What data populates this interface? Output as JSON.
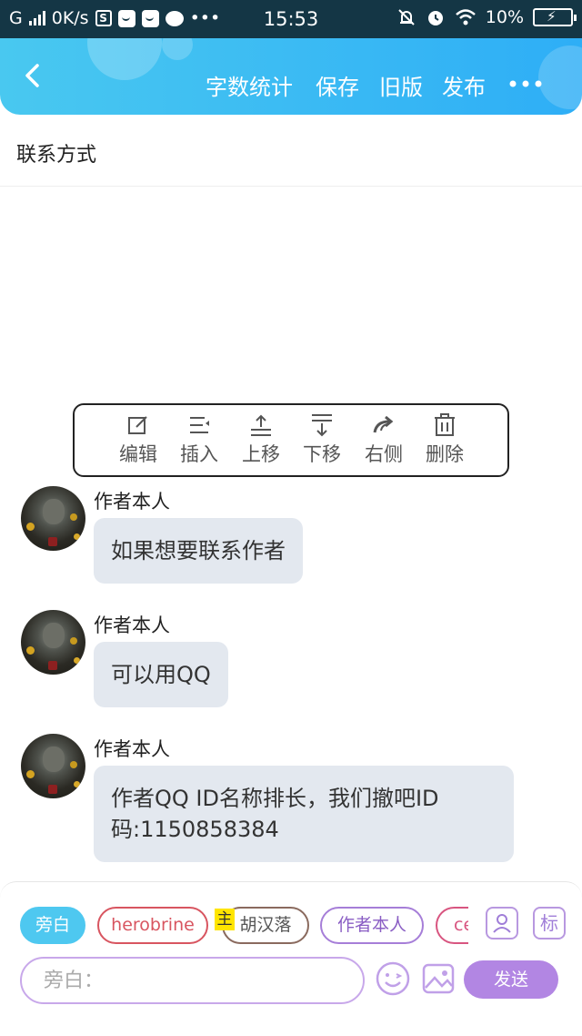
{
  "status_bar": {
    "carrier": "G",
    "net_speed": "0K/s",
    "time": "15:53",
    "battery": "10%"
  },
  "header": {
    "actions": [
      "字数统计",
      "保存",
      "旧版",
      "发布"
    ]
  },
  "page": {
    "title": "联系方式"
  },
  "toolbar": {
    "items": [
      "编辑",
      "插入",
      "上移",
      "下移",
      "右侧",
      "删除"
    ]
  },
  "messages": [
    {
      "sender": "作者本人",
      "text": "如果想要联系作者"
    },
    {
      "sender": "作者本人",
      "text": "可以用QQ"
    },
    {
      "sender": "作者本人",
      "line1": "作者QQ ID名称排长，我们撤吧ID",
      "line2": "码:1150858384"
    }
  ],
  "composer": {
    "chips": [
      "旁白",
      "herobrine",
      "胡汉落",
      "作者本人",
      "ce"
    ],
    "host_badge": "主",
    "tag_button": "标",
    "placeholder": "旁白：",
    "send_label": "发送"
  }
}
